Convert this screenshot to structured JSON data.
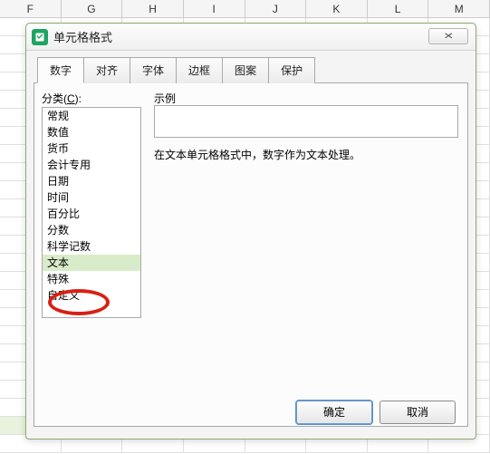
{
  "columns": [
    "F",
    "G",
    "H",
    "I",
    "J",
    "K",
    "L",
    "M"
  ],
  "dialog": {
    "title": "单元格格式",
    "close_glyph": "✕",
    "tabs": [
      {
        "label": "数字",
        "active": true
      },
      {
        "label": "对齐",
        "active": false
      },
      {
        "label": "字体",
        "active": false
      },
      {
        "label": "边框",
        "active": false
      },
      {
        "label": "图案",
        "active": false
      },
      {
        "label": "保护",
        "active": false
      }
    ],
    "category_label_pre": "分类(",
    "category_label_hot": "C",
    "category_label_post": "):",
    "categories": [
      {
        "label": "常规",
        "selected": false
      },
      {
        "label": "数值",
        "selected": false
      },
      {
        "label": "货币",
        "selected": false
      },
      {
        "label": "会计专用",
        "selected": false
      },
      {
        "label": "日期",
        "selected": false
      },
      {
        "label": "时间",
        "selected": false
      },
      {
        "label": "百分比",
        "selected": false
      },
      {
        "label": "分数",
        "selected": false
      },
      {
        "label": "科学记数",
        "selected": false
      },
      {
        "label": "文本",
        "selected": true
      },
      {
        "label": "特殊",
        "selected": false
      },
      {
        "label": "自定义",
        "selected": false
      }
    ],
    "preview_label": "示例",
    "description": "在文本单元格格式中，数字作为文本处理。",
    "ok_label": "确定",
    "cancel_label": "取消"
  }
}
